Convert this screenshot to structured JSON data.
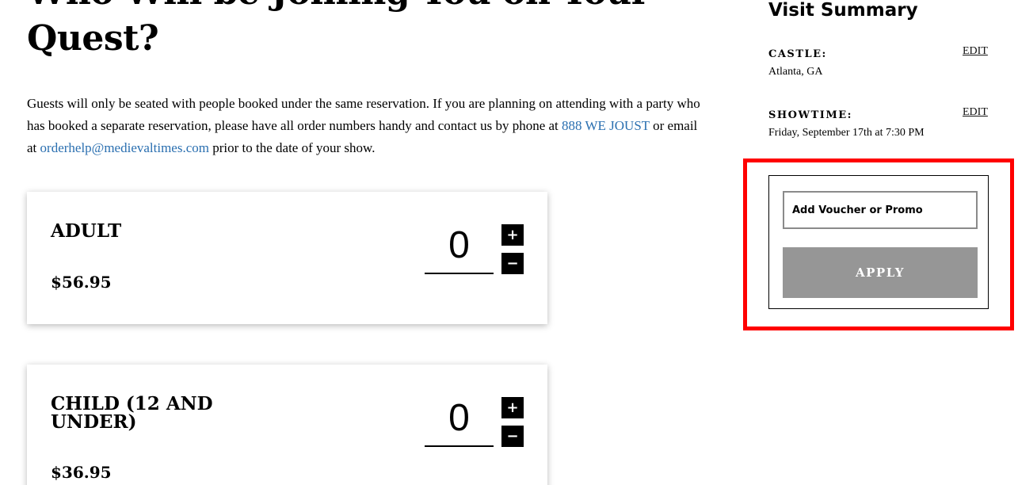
{
  "main": {
    "heading": "Who Will be Joining You on Your Quest?",
    "intro": {
      "text_before": "Guests will only be seated with people booked under the same reservation. If you are planning on attending with a party who has booked a separate reservation, please have all order numbers handy and contact us by phone at ",
      "phone_link": "888 WE JOUST",
      "text_middle": " or email at ",
      "email_link": "orderhelp@medievaltimes.com",
      "text_after": " prior to the date of your show."
    },
    "tickets": [
      {
        "name": "ADULT",
        "price": "$56.95",
        "quantity": "0",
        "plus": "+",
        "minus": "−"
      },
      {
        "name": "CHILD (12 AND UNDER)",
        "price": "$36.95",
        "quantity": "0",
        "plus": "+",
        "minus": "−"
      }
    ]
  },
  "sidebar": {
    "title": "Visit Summary",
    "castle_label": "CASTLE:",
    "castle_value": "Atlanta, GA",
    "showtime_label": "SHOWTIME:",
    "showtime_value": "Friday, September 17th at 7:30 PM",
    "edit_label": "EDIT",
    "promo": {
      "placeholder": "Add Voucher or Promo",
      "value": "",
      "apply_label": "APPLY"
    }
  },
  "colors": {
    "link": "#2a6fb0",
    "highlight": "#ff0000",
    "apply_button": "#969696"
  }
}
